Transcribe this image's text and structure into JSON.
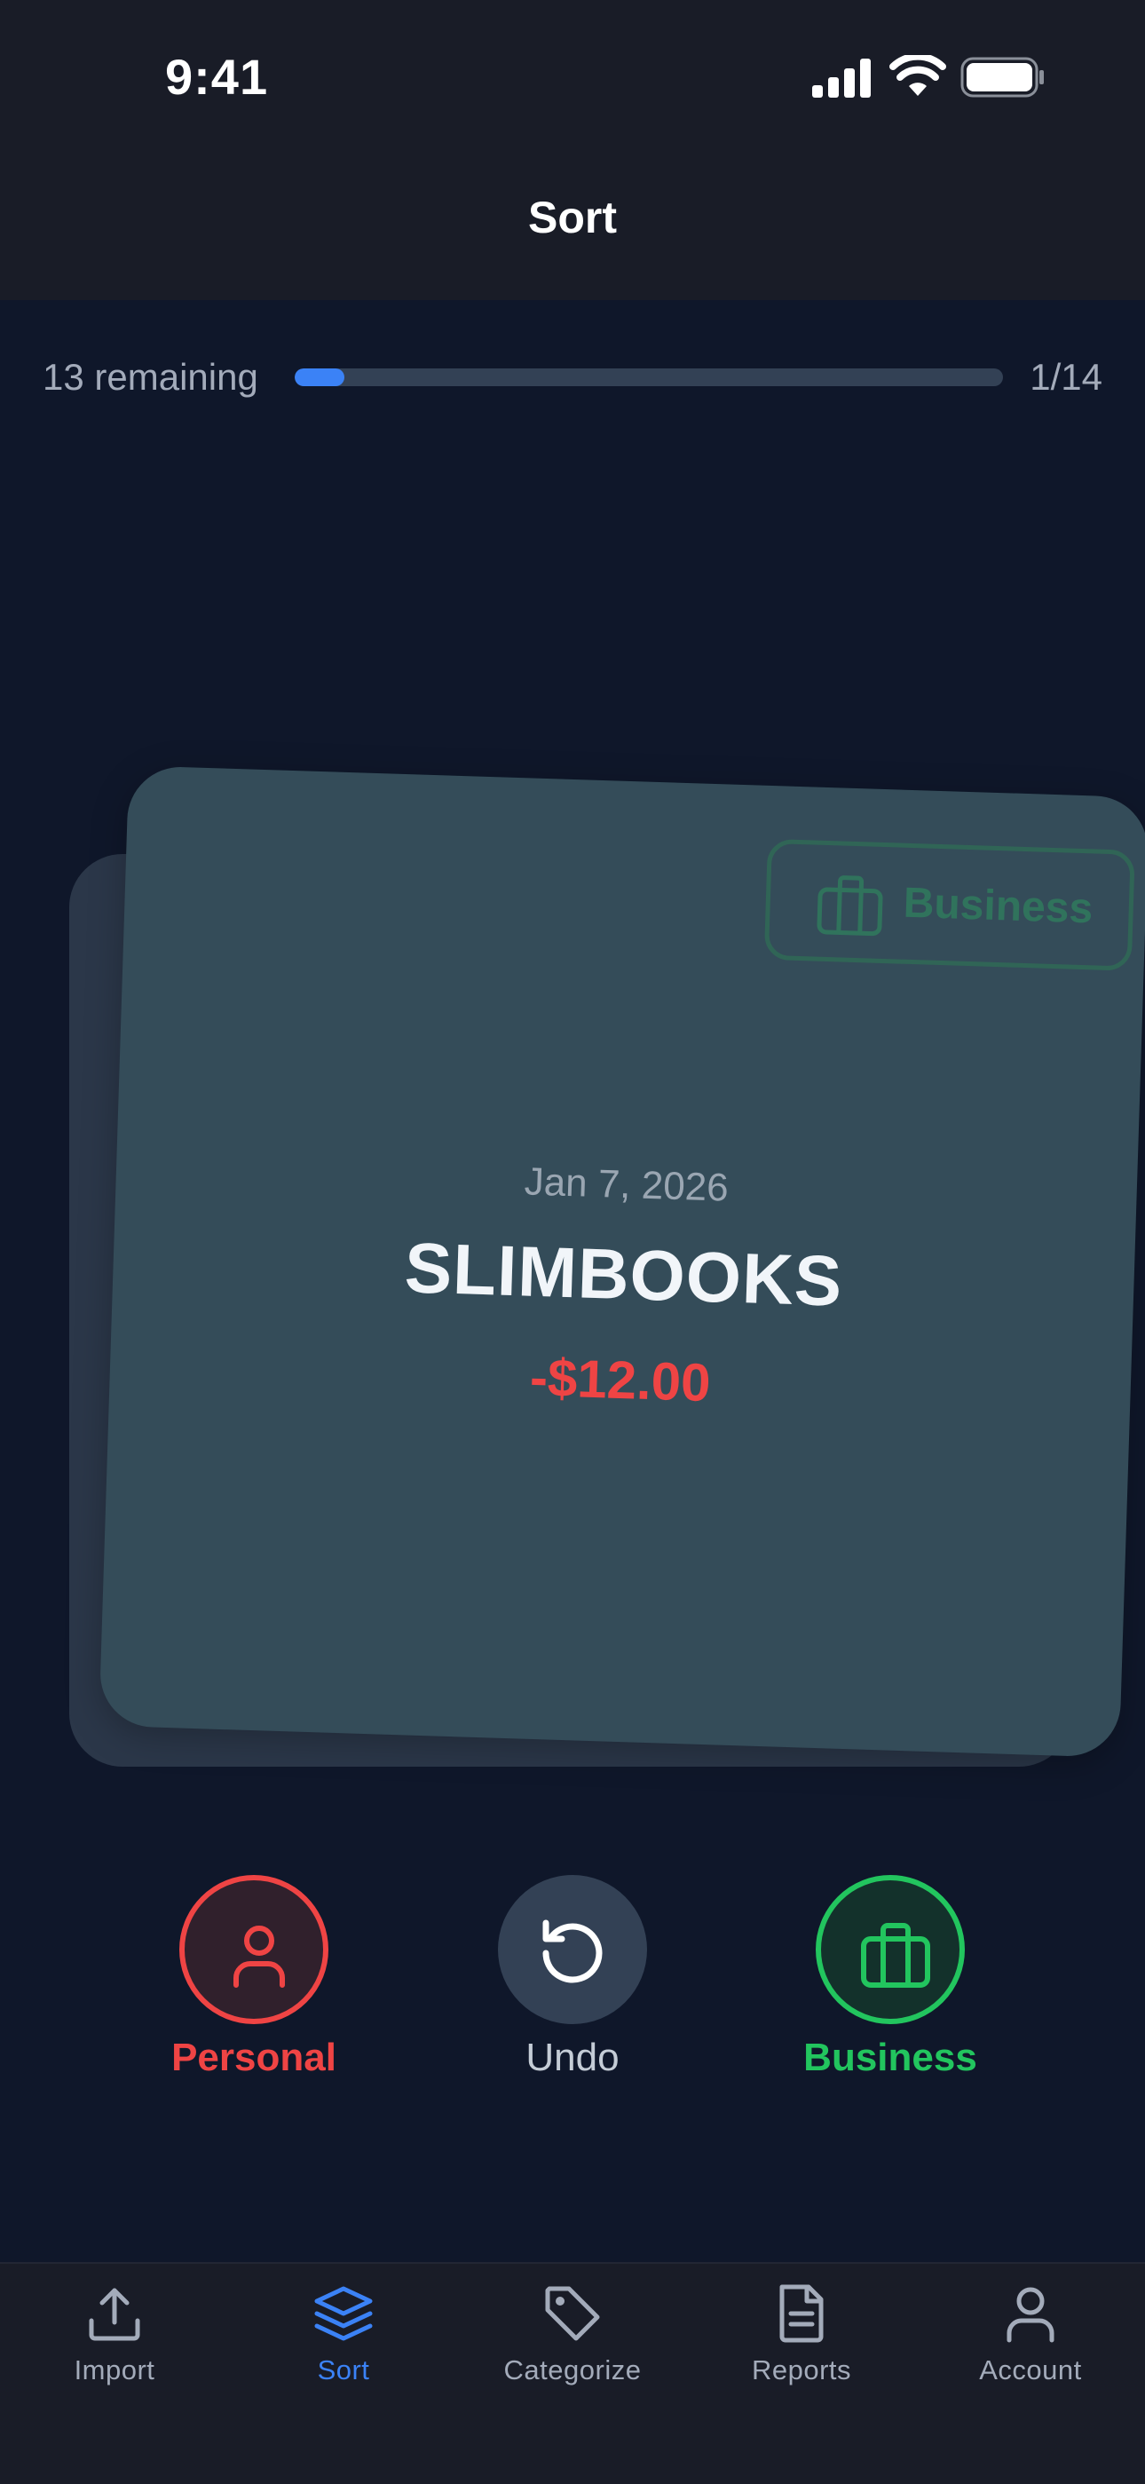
{
  "status_bar": {
    "time": "9:41"
  },
  "nav": {
    "title": "Sort"
  },
  "progress": {
    "remaining_text": "13 remaining",
    "counter": "1/14",
    "fraction": 0.07
  },
  "card": {
    "date": "Jan 7, 2026",
    "merchant": "SLIMBOOKS",
    "amount": "-$12.00",
    "stamp_label": "Business"
  },
  "actions": {
    "personal": "Personal",
    "undo": "Undo",
    "business": "Business"
  },
  "tabs": [
    {
      "label": "Import",
      "icon": "upload-icon"
    },
    {
      "label": "Sort",
      "icon": "layers-icon",
      "active": true
    },
    {
      "label": "Categorize",
      "icon": "tag-icon"
    },
    {
      "label": "Reports",
      "icon": "document-icon"
    },
    {
      "label": "Account",
      "icon": "user-icon"
    }
  ],
  "colors": {
    "accent": "#3b82f6",
    "personal": "#ef4444",
    "business": "#22c55e",
    "background": "#0f172a",
    "card": "#344c59"
  }
}
